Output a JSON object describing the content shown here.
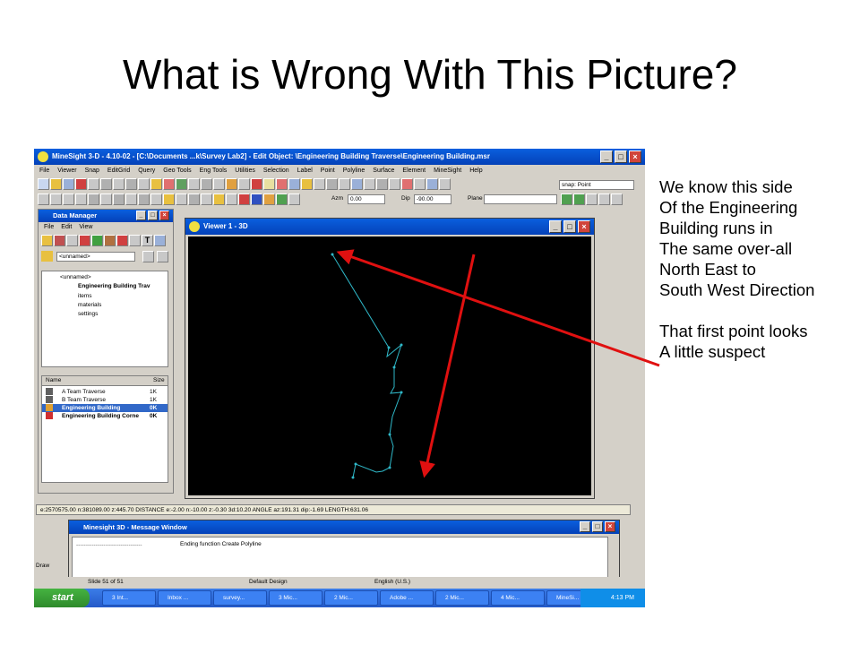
{
  "slide": {
    "title": "What is Wrong With This Picture?",
    "notes": [
      "We know this side",
      "Of the Engineering",
      "Building runs in",
      "The same over-all",
      "North East to",
      "South West Direction"
    ],
    "notes2": [
      "That first point looks",
      "A little suspect"
    ],
    "arrow_color": "#e01010"
  },
  "app": {
    "title": "MineSight 3-D - 4.10-02 - [C:\\Documents ...k\\Survey Lab2] - Edit Object: \\Engineering Building Traverse\\Engineering Building.msr",
    "menu": [
      "File",
      "Viewer",
      "Snap",
      "EditGrid",
      "Query",
      "Geo Tools",
      "Eng Tools",
      "Utilities",
      "Selection",
      "Label",
      "Point",
      "Polyline",
      "Surface",
      "Element",
      "MineSight",
      "Help"
    ],
    "azm_label": "Azm",
    "azm_value": "0.00",
    "dip_label": "Dip",
    "dip_value": "-90.00",
    "plane_label": "Plane",
    "snap_label": "snap: Point"
  },
  "data_manager": {
    "title": "Data Manager",
    "menu": [
      "File",
      "Edit",
      "View"
    ],
    "folder": "<unnamed>",
    "tree": [
      "<unnamed>",
      "Engineering Building Trav",
      "items",
      "materials",
      "settings"
    ],
    "list_headers": [
      "Name",
      "Size"
    ],
    "rows": [
      {
        "name": "A Team Traverse",
        "size": "1K"
      },
      {
        "name": "B Team Traverse",
        "size": "1K"
      },
      {
        "name": "Engineering Building",
        "size": "0K"
      },
      {
        "name": "Engineering Building Corne",
        "size": "0K"
      }
    ]
  },
  "viewer": {
    "title": "Viewer 1 - 3D",
    "line_color": "#2fb8c8"
  },
  "status": "e:2570575.00  n:381089.00  z:445.70  DISTANCE  e:-2.00  n:-10.00  z:-0.30  3d:10.20   ANGLE  az:191.31  dip:-1.69   LENGTH:631.06",
  "message_window": {
    "title": "Minesight 3D - Message Window",
    "text": "Ending function Create Polyline"
  },
  "ppt": {
    "slide_info": "Slide 51 of 51",
    "design": "Default Design",
    "language": "English (U.S.)",
    "draw": "Draw"
  },
  "taskbar": {
    "start": "start",
    "tasks": [
      "3 Int...",
      "Inbox ...",
      "survey...",
      "3 Mic...",
      "2 Mic...",
      "Adobe ...",
      "2 Mic...",
      "4 Mic...",
      "MineSi..."
    ],
    "clock": "4:13 PM"
  }
}
